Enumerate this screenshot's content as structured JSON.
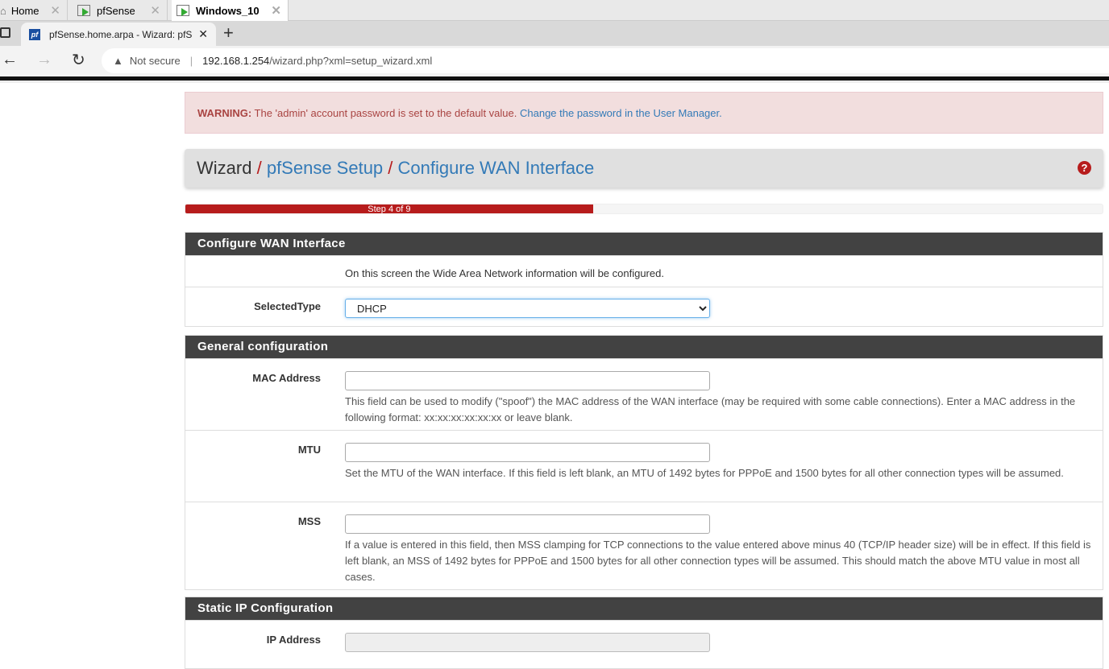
{
  "vm_tabs": [
    {
      "label": "Home"
    },
    {
      "label": "pfSense"
    },
    {
      "label": "Windows_10"
    }
  ],
  "browser": {
    "tab_title": "pfSense.home.arpa - Wizard: pfS",
    "not_secure": "Not secure",
    "url_host": "192.168.1.254",
    "url_path": "/wizard.php?xml=setup_wizard.xml",
    "favicon": "pf"
  },
  "warning": {
    "label": "WARNING:",
    "text": " The 'admin' account password is set to the default value. ",
    "link": "Change the password in the User Manager."
  },
  "breadcrumb": {
    "root": "Wizard",
    "sep": "/",
    "setup": "pfSense Setup",
    "current": "Configure WAN Interface"
  },
  "progress": {
    "label": "Step 4 of 9",
    "step": 4,
    "total": 9
  },
  "sections": {
    "wan": {
      "title": "Configure WAN Interface",
      "intro": "On this screen the Wide Area Network information will be configured.",
      "selected_type_label": "SelectedType",
      "selected_type_value": "DHCP"
    },
    "general": {
      "title": "General configuration",
      "mac_label": "MAC Address",
      "mac_help": "This field can be used to modify (\"spoof\") the MAC address of the WAN interface (may be required with some cable connections). Enter a MAC address in the following format: xx:xx:xx:xx:xx:xx or leave blank.",
      "mtu_label": "MTU",
      "mtu_help": "Set the MTU of the WAN interface. If this field is left blank, an MTU of 1492 bytes for PPPoE and 1500 bytes for all other connection types will be assumed.",
      "mss_label": "MSS",
      "mss_help": "If a value is entered in this field, then MSS clamping for TCP connections to the value entered above minus 40 (TCP/IP header size) will be in effect. If this field is left blank, an MSS of 1492 bytes for PPPoE and 1500 bytes for all other connection types will be assumed. This should match the above MTU value in most all cases."
    },
    "static": {
      "title": "Static IP Configuration",
      "ip_label": "IP Address"
    }
  }
}
